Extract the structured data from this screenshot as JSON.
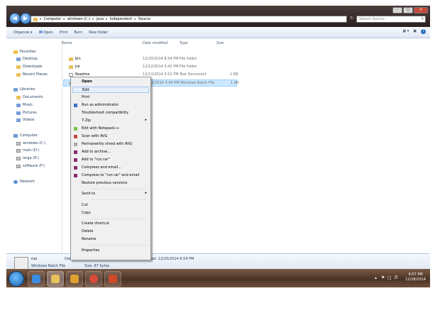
{
  "titlebar": {
    "breadcrumb": [
      "Computer",
      "windows (C:)",
      "java",
      "Independent",
      "Source"
    ],
    "search_placeholder": "Search Source",
    "search_icon": "magnifier-icon"
  },
  "toolbar": {
    "organize": "Organize ▾",
    "open": "Open",
    "print": "Print",
    "burn": "Burn",
    "new_folder": "New folder"
  },
  "sidebar": {
    "favorites": "Favorites",
    "desktop": "Desktop",
    "downloads": "Downloads",
    "recent": "Recent Places",
    "libraries": "Libraries",
    "documents": "Documents",
    "music": "Music",
    "pictures": "Pictures",
    "videos": "Videos",
    "computer": "Computer",
    "drive_c": "windows (C:)",
    "drive_d": "main (D:)",
    "drive_e": "large (E:)",
    "drive_f": "software (F:)",
    "network": "Network"
  },
  "columns": {
    "name": "Name",
    "date": "Date modified",
    "type": "Type",
    "size": "Size"
  },
  "files": [
    {
      "name": "bin",
      "date": "12/20/2014 8:54 PM",
      "type": "File folder",
      "size": ""
    },
    {
      "name": "jre",
      "date": "12/12/2014 3:42 PM",
      "type": "File folder",
      "size": ""
    },
    {
      "name": "Readme",
      "date": "12/12/2014 3:52 PM",
      "type": "Text Document",
      "size": "1 KB"
    },
    {
      "name": "",
      "date": "12/12/2014 3:49 PM",
      "type": "Windows Batch File",
      "size": "1 KB"
    }
  ],
  "context_menu": {
    "open": "Open",
    "edit": "Edit",
    "print": "Print",
    "run_admin": "Run as administrator",
    "troubleshoot": "Troubleshoot compatibility",
    "zip": "7-Zip",
    "notepadpp": "Edit with Notepad++",
    "scan": "Scan with AVG",
    "shred": "Permanently shred with AVG",
    "add_archive": "Add to archive...",
    "add_rar": "Add to \"run.rar\"",
    "compress_email": "Compress and email...",
    "compress_rar_email": "Compress to \"run.rar\" and email",
    "restore": "Restore previous versions",
    "send_to": "Send to",
    "cut": "Cut",
    "copy": "Copy",
    "create_shortcut": "Create shortcut",
    "delete": "Delete",
    "rename": "Rename",
    "properties": "Properties"
  },
  "details": {
    "name": "run",
    "type": "Windows Batch File",
    "modified": "Date modified: 12/12/2014 3:49 PM",
    "size": "Size: 87 bytes",
    "created": "Date created: 12/20/2014 8:54 PM"
  },
  "tray": {
    "time": "9:57 PM",
    "date": "12/28/2014"
  },
  "colors": {
    "accent": "#1e395b",
    "selection": "#cce8ff",
    "taskbar": "#4b3224"
  }
}
